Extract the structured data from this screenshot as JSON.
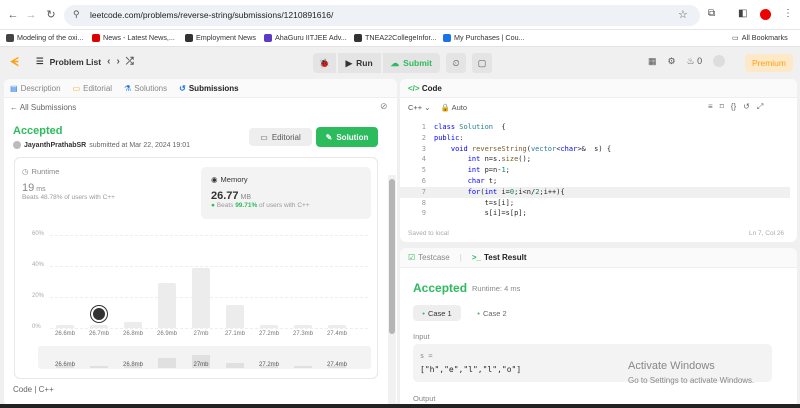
{
  "browser": {
    "url": "leetcode.com/problems/reverse-string/submissions/1210891616/",
    "back_icon": "←",
    "forward_icon": "→",
    "reload_icon": "↻",
    "bookmarks": [
      {
        "label": "Modeling of the oxi...",
        "color": "#444"
      },
      {
        "label": "News - Latest News,...",
        "color": "#d00"
      },
      {
        "label": "Employment News",
        "color": "#333"
      },
      {
        "label": "AhaGuru IITJEE Adv...",
        "color": "#5b3cc4"
      },
      {
        "label": "TNEA22CollegeInfor...",
        "color": "#333"
      },
      {
        "label": "My Purchases | Cou...",
        "color": "#1a73e8"
      }
    ],
    "all_bookmarks": "All Bookmarks"
  },
  "nav": {
    "problem_list": "Problem List",
    "run": "Run",
    "submit": "Submit",
    "streak": "0",
    "premium": "Premium"
  },
  "left": {
    "tabs": [
      {
        "label": "Description",
        "icon": "▤",
        "active": false
      },
      {
        "label": "Editorial",
        "icon": "▭",
        "active": false
      },
      {
        "label": "Solutions",
        "icon": "⚗",
        "active": false
      },
      {
        "label": "Submissions",
        "icon": "↺",
        "active": true
      }
    ],
    "all_submissions": "All Submissions",
    "status": "Accepted",
    "username": "JayanthPrathabSR",
    "submitted_at": "submitted at Mar 22, 2024 19:01",
    "editorial_btn": "Editorial",
    "solution_btn": "Solution",
    "runtime": {
      "label": "Runtime",
      "value": "19",
      "unit": "ms",
      "beats_prefix": "Beats",
      "beats": "48.78%",
      "beats_suffix": "of users with C++"
    },
    "memory": {
      "label": "Memory",
      "value": "26.77",
      "unit": "MB",
      "beats_prefix": "Beats",
      "beats": "99.71%",
      "beats_suffix": "of users with C++"
    },
    "code_label": "Code",
    "code_lang": "C++"
  },
  "chart_data": {
    "type": "bar",
    "categories": [
      "26.6mb",
      "26.7mb",
      "26.8mb",
      "26.9mb",
      "27mb",
      "27.1mb",
      "27.2mb",
      "27.3mb",
      "27.4mb"
    ],
    "values": [
      1,
      1,
      4,
      29,
      39,
      15,
      1,
      1,
      1
    ],
    "ylim": [
      0,
      60
    ],
    "yticks": [
      "0%",
      "20%",
      "40%",
      "60%"
    ],
    "mini_labels": [
      "26.6mb",
      "26.8mb",
      "27mb",
      "27.2mb",
      "27.4mb"
    ],
    "selected_index": 1
  },
  "code": {
    "title": "Code",
    "lang": "C++",
    "mode": "Auto",
    "lines": [
      [
        [
          "kw",
          "class "
        ],
        [
          "ty",
          "Solution"
        ],
        [
          "",
          "  {"
        ]
      ],
      [
        [
          "kw",
          "public"
        ],
        [
          "",
          ":"
        ]
      ],
      [
        [
          "",
          "    "
        ],
        [
          "kw",
          "void "
        ],
        [
          "fn",
          "reverseString"
        ],
        [
          "",
          "("
        ],
        [
          "ty",
          "vector"
        ],
        [
          "",
          "<"
        ],
        [
          "kw",
          "char"
        ],
        [
          "",
          ">&  s) {"
        ]
      ],
      [
        [
          "",
          "        "
        ],
        [
          "kw",
          "int "
        ],
        [
          "",
          "n=s."
        ],
        [
          "fn",
          "size"
        ],
        [
          "",
          "();"
        ]
      ],
      [
        [
          "",
          "        "
        ],
        [
          "kw",
          "int "
        ],
        [
          "",
          "p=n-"
        ],
        [
          "nm",
          "1"
        ],
        [
          "",
          ";"
        ]
      ],
      [
        [
          "",
          "        "
        ],
        [
          "kw",
          "char "
        ],
        [
          "",
          "t;"
        ]
      ],
      [
        [
          "",
          "        "
        ],
        [
          "kw",
          "for"
        ],
        [
          "",
          "("
        ],
        [
          "kw",
          "int "
        ],
        [
          "",
          "i="
        ],
        [
          "nm",
          "0"
        ],
        [
          "",
          ";i<n/"
        ],
        [
          "nm",
          "2"
        ],
        [
          "",
          ";i++){"
        ]
      ],
      [
        [
          "",
          "            t=s[i];"
        ]
      ],
      [
        [
          "",
          "            s[i]=s[p];"
        ]
      ]
    ],
    "highlight_line": 7,
    "saved": "Saved to local",
    "position": "Ln 7, Col 26"
  },
  "test": {
    "tab_testcase": "Testcase",
    "tab_result": "Test Result",
    "status": "Accepted",
    "runtime": "Runtime: 4 ms",
    "case1": "Case 1",
    "case2": "Case 2",
    "input_label": "Input",
    "var": "s =",
    "value": "[\"h\",\"e\",\"l\",\"l\",\"o\"]",
    "output_label": "Output"
  },
  "watermark": {
    "line1": "Activate Windows",
    "line2": "Go to Settings to activate Windows."
  }
}
